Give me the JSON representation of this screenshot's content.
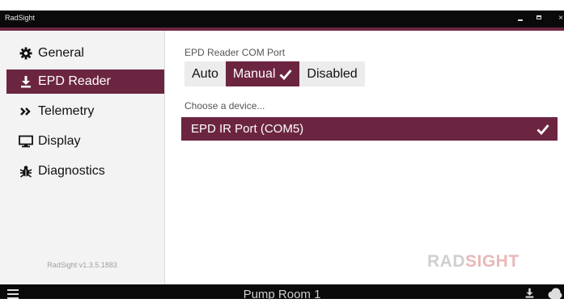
{
  "window": {
    "title": "RadSight",
    "minimize_icon": "minimize-icon",
    "maximize_icon": "maximize-icon",
    "close_label": "×"
  },
  "sidebar": {
    "items": [
      {
        "label": "General",
        "icon": "gear-icon",
        "active": false
      },
      {
        "label": "EPD Reader",
        "icon": "download-icon",
        "active": true
      },
      {
        "label": "Telemetry",
        "icon": "double-chevron-right-icon",
        "active": false
      },
      {
        "label": "Display",
        "icon": "monitor-icon",
        "active": false
      },
      {
        "label": "Diagnostics",
        "icon": "bug-icon",
        "active": false
      }
    ],
    "version": "RadSight v1.3.5.1883"
  },
  "main": {
    "com_port_label": "EPD Reader COM Port",
    "com_port_options": [
      "Auto",
      "Manual",
      "Disabled"
    ],
    "com_port_selected": "Manual",
    "device_prompt": "Choose a device...",
    "selected_device": "EPD IR Port (COM5)"
  },
  "branding": {
    "logo_part1": "RAD",
    "logo_part2": "SIGHT"
  },
  "bottombar": {
    "location": "Pump Room 1",
    "menu_icon": "hamburger-menu-icon",
    "download_icon": "download-icon",
    "cloud_icon": "cloud-icon"
  },
  "colors": {
    "accent": "#6c2541",
    "title_bar": "#0a0a0a",
    "sidebar_bg": "#f3f3f3",
    "logo_gray": "#cfcfcf",
    "logo_pink": "#e8b8b8"
  }
}
